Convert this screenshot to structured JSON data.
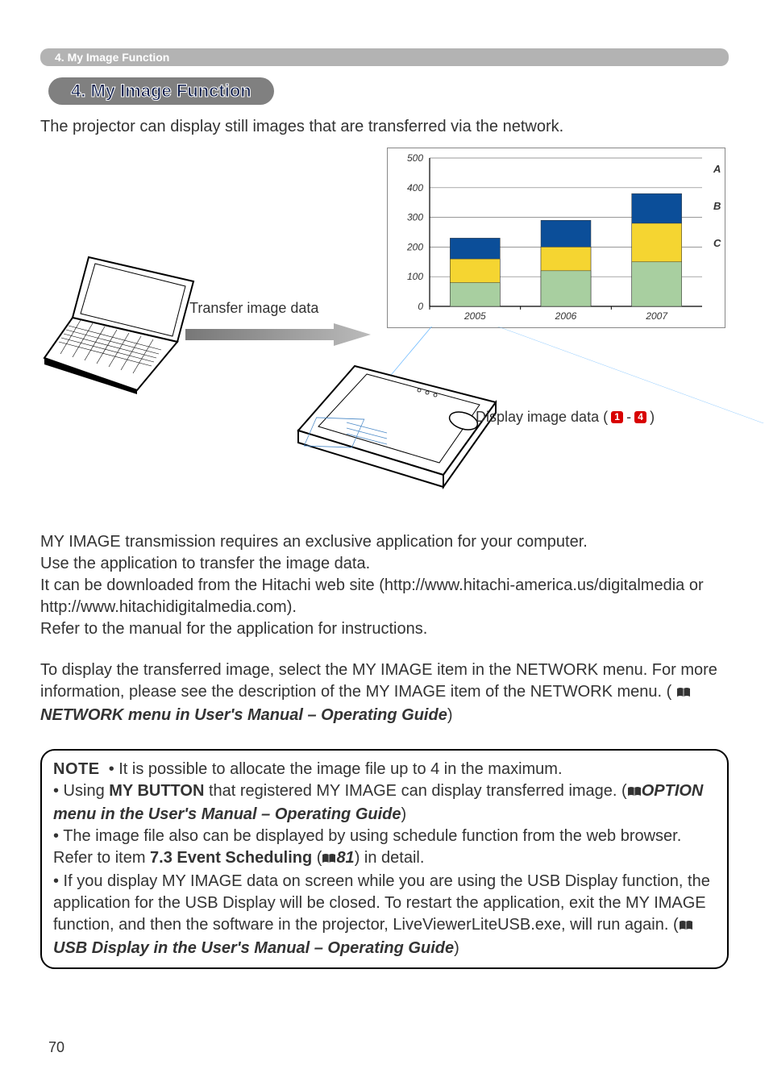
{
  "breadcrumb": "4. My Image Function",
  "section_title": "4. My Image Function",
  "intro": "The projector can display still images that are transferred via the network.",
  "diagram": {
    "transfer_label": "Transfer image data",
    "display_label_prefix": "Display image data (",
    "display_label_badge1": "1",
    "display_label_dash": " - ",
    "display_label_badge2": "4",
    "display_label_suffix": ")"
  },
  "chart_data": {
    "type": "bar",
    "categories": [
      "2005",
      "2006",
      "2007"
    ],
    "series": [
      {
        "name": "A",
        "color": "#0b4e99",
        "values": [
          230,
          290,
          380
        ]
      },
      {
        "name": "B",
        "color": "#f5d531",
        "values": [
          160,
          200,
          280
        ]
      },
      {
        "name": "C",
        "color": "#a8cfa0",
        "values": [
          80,
          120,
          150
        ]
      }
    ],
    "ylim": [
      0,
      500
    ],
    "yticks": [
      0,
      100,
      200,
      300,
      400,
      500
    ],
    "stacked": false,
    "overlay": true,
    "legend_position": "right"
  },
  "body_p1_l1": "MY IMAGE transmission requires an exclusive application for your computer.",
  "body_p1_l2": "Use the application to transfer the image data.",
  "body_p1_l3": "It can be downloaded from the Hitachi web site (http://www.hitachi-america.us/digitalmedia or http://www.hitachidigitalmedia.com).",
  "body_p1_l4": "Refer to the manual for the application for instructions.",
  "body_p2_a": "To display the transferred image, select the MY IMAGE item in the NETWORK menu. For more information, please see the description of the MY IMAGE item of the NETWORK menu. (",
  "body_p2_ref": "NETWORK menu in User's Manual – Operating Guide",
  "body_p2_b": ")",
  "note": {
    "label": "NOTE",
    "b1": "• It is possible to allocate the image file up to 4 in the maximum.",
    "b2_a": "• Using ",
    "b2_bold": "MY BUTTON",
    "b2_b": " that registered MY IMAGE can display transferred image. (",
    "b2_ref": "OPTION menu in the User's Manual – Operating Guide",
    "b2_c": ")",
    "b3_a": "• The image file also can be displayed by using schedule function from the web browser. Refer to item ",
    "b3_bold": "7.3 Event Scheduling",
    "b3_b": " (",
    "b3_page": "81",
    "b3_c": ") in detail.",
    "b4_a": "• If you display MY IMAGE data on screen while you are using the USB Display function, the application for the USB Display will be closed. To restart the application, exit the MY IMAGE function, and then the software in the projector, LiveViewerLiteUSB.exe, will run again. (",
    "b4_ref": "USB Display in the User's Manual – Operating Guide",
    "b4_b": ")"
  },
  "page_number": "70"
}
